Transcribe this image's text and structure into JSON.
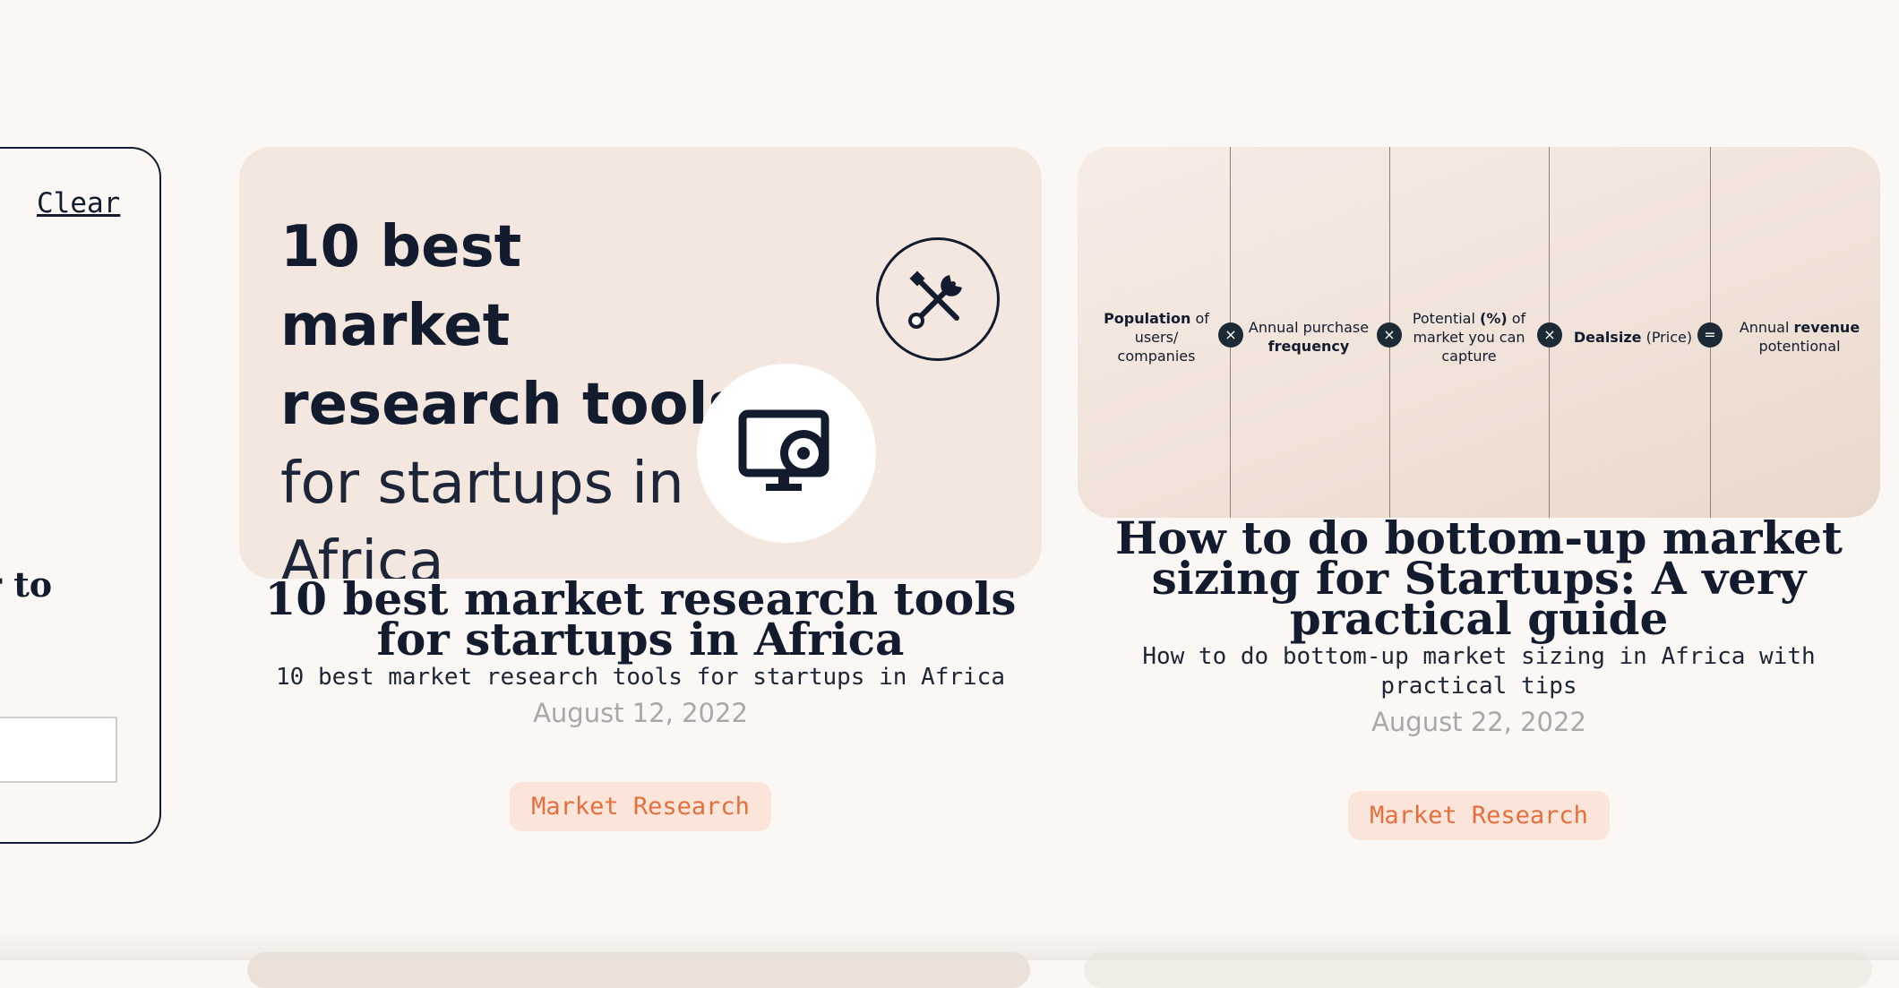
{
  "filter_panel": {
    "clear_label": "Clear",
    "partial_text": "r to"
  },
  "cards": [
    {
      "thumbnail": {
        "title_bold_line1": "10 best market",
        "title_bold_line2": "research tools",
        "title_light_line1": "for startups in",
        "title_light_line2": "Africa",
        "icons": [
          "tools-icon",
          "monitor-icon"
        ]
      },
      "title": "10 best market research tools for startups in Africa",
      "description": "10 best market research tools for startups in Africa",
      "date": "August 12, 2022",
      "tag": "Market Research"
    },
    {
      "thumbnail": {
        "formula": [
          {
            "bold": "Population",
            "rest": " of users/ companies"
          },
          {
            "pre": "Annual purchase ",
            "bold": "frequency"
          },
          {
            "pre": "Potential ",
            "bold": "(%)",
            "rest": " of market you can capture"
          },
          {
            "bold": "Dealsize",
            "rest": " (Price)"
          },
          {
            "pre": "Annual ",
            "bold": "revenue",
            "rest": " potentional"
          }
        ],
        "operators": [
          "×",
          "×",
          "×",
          "="
        ]
      },
      "title": "How to do bottom-up market sizing for Startups: A very practical guide",
      "description": "How to do bottom-up market sizing in Africa with practical tips",
      "date": "August 22, 2022",
      "tag": "Market Research"
    }
  ],
  "colors": {
    "background": "#fbf7f4",
    "text": "#131c2e",
    "tag_bg": "#fbe5da",
    "tag_text": "#e36f3d",
    "date": "#a8a8a8"
  }
}
